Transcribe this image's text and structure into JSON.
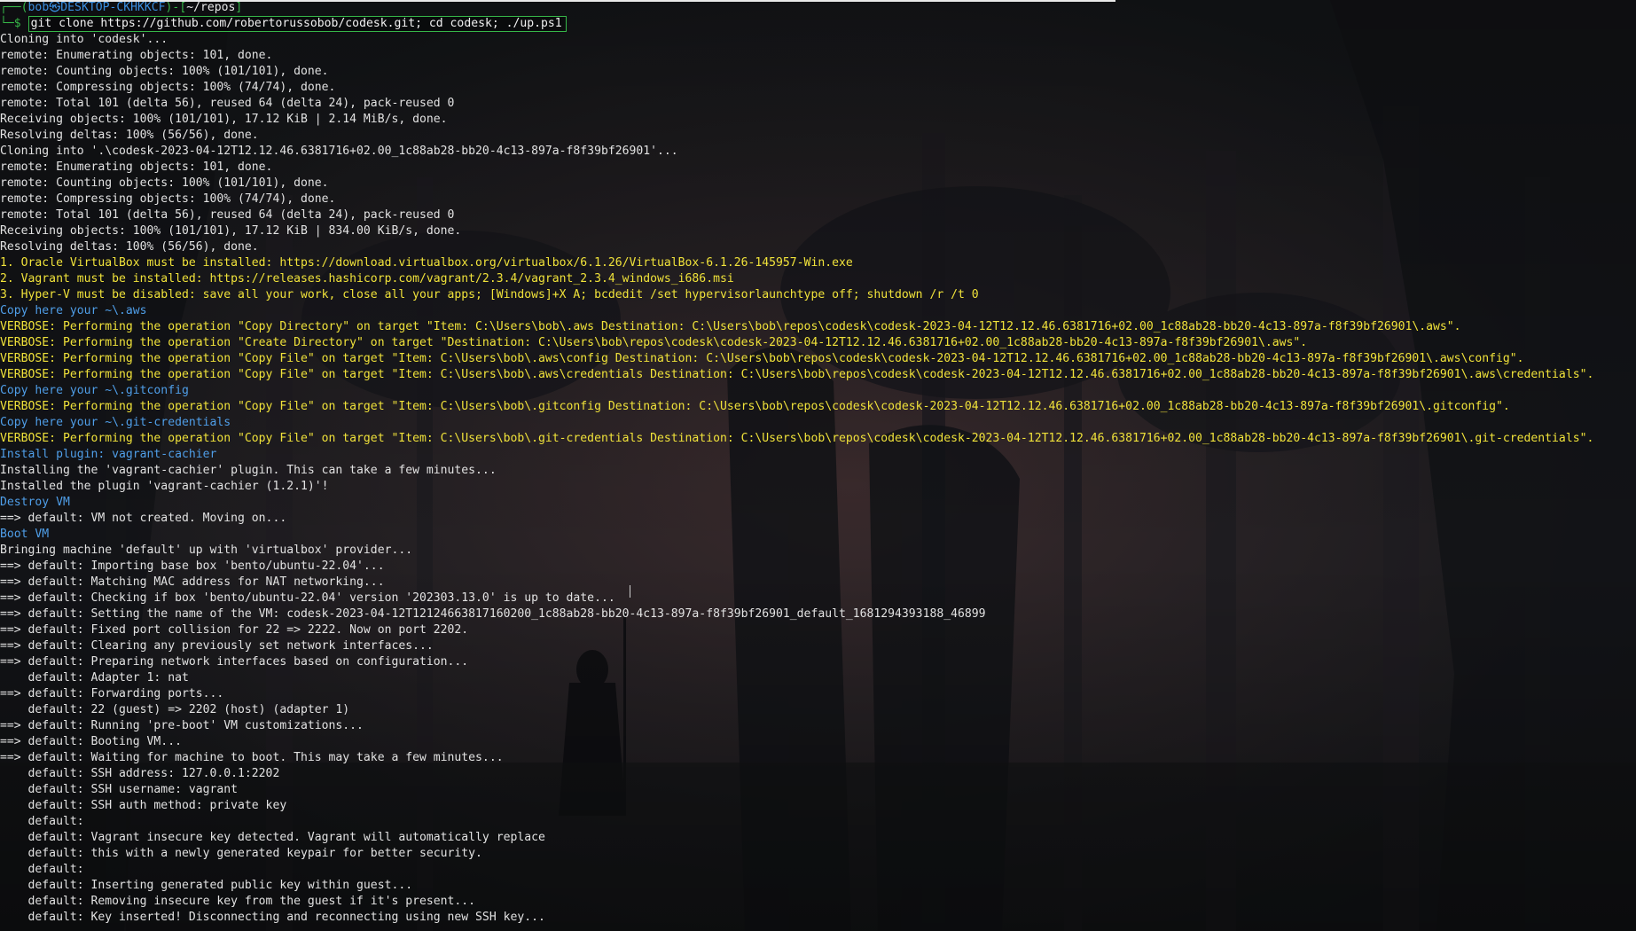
{
  "prompt": {
    "user_host": "bob㉿DESKTOP-CKHKKCF",
    "cwd": "~/repos",
    "symbol": "$",
    "command": "git clone https://github.com/robertorussobob/codesk.git; cd codesk; ./up.ps1"
  },
  "lines": [
    {
      "text": "Cloning into 'codesk'...",
      "c": "default"
    },
    {
      "text": "remote: Enumerating objects: 101, done.",
      "c": "default"
    },
    {
      "text": "remote: Counting objects: 100% (101/101), done.",
      "c": "default"
    },
    {
      "text": "remote: Compressing objects: 100% (74/74), done.",
      "c": "default"
    },
    {
      "text": "remote: Total 101 (delta 56), reused 64 (delta 24), pack-reused 0",
      "c": "default"
    },
    {
      "text": "Receiving objects: 100% (101/101), 17.12 KiB | 2.14 MiB/s, done.",
      "c": "default"
    },
    {
      "text": "Resolving deltas: 100% (56/56), done.",
      "c": "default"
    },
    {
      "text": "Cloning into '.\\codesk-2023-04-12T12.12.46.6381716+02.00_1c88ab28-bb20-4c13-897a-f8f39bf26901'...",
      "c": "default"
    },
    {
      "text": "remote: Enumerating objects: 101, done.",
      "c": "default"
    },
    {
      "text": "remote: Counting objects: 100% (101/101), done.",
      "c": "default"
    },
    {
      "text": "remote: Compressing objects: 100% (74/74), done.",
      "c": "default"
    },
    {
      "text": "remote: Total 101 (delta 56), reused 64 (delta 24), pack-reused 0",
      "c": "default"
    },
    {
      "text": "Receiving objects: 100% (101/101), 17.12 KiB | 834.00 KiB/s, done.",
      "c": "default"
    },
    {
      "text": "Resolving deltas: 100% (56/56), done.",
      "c": "default"
    },
    {
      "text": "1. Oracle VirtualBox must be installed: https://download.virtualbox.org/virtualbox/6.1.26/VirtualBox-6.1.26-145957-Win.exe",
      "c": "yellow"
    },
    {
      "text": "2. Vagrant must be installed: https://releases.hashicorp.com/vagrant/2.3.4/vagrant_2.3.4_windows_i686.msi",
      "c": "yellow"
    },
    {
      "text": "3. Hyper-V must be disabled: save all your work, close all your apps; [Windows]+X A; bcdedit /set hypervisorlaunchtype off; shutdown /r /t 0",
      "c": "yellow"
    },
    {
      "text": "Copy here your ~\\.aws",
      "c": "blue"
    },
    {
      "text": "VERBOSE: Performing the operation \"Copy Directory\" on target \"Item: C:\\Users\\bob\\.aws Destination: C:\\Users\\bob\\repos\\codesk\\codesk-2023-04-12T12.12.46.6381716+02.00_1c88ab28-bb20-4c13-897a-f8f39bf26901\\.aws\".",
      "c": "yellow"
    },
    {
      "text": "VERBOSE: Performing the operation \"Create Directory\" on target \"Destination: C:\\Users\\bob\\repos\\codesk\\codesk-2023-04-12T12.12.46.6381716+02.00_1c88ab28-bb20-4c13-897a-f8f39bf26901\\.aws\".",
      "c": "yellow"
    },
    {
      "text": "VERBOSE: Performing the operation \"Copy File\" on target \"Item: C:\\Users\\bob\\.aws\\config Destination: C:\\Users\\bob\\repos\\codesk\\codesk-2023-04-12T12.12.46.6381716+02.00_1c88ab28-bb20-4c13-897a-f8f39bf26901\\.aws\\config\".",
      "c": "yellow"
    },
    {
      "text": "VERBOSE: Performing the operation \"Copy File\" on target \"Item: C:\\Users\\bob\\.aws\\credentials Destination: C:\\Users\\bob\\repos\\codesk\\codesk-2023-04-12T12.12.46.6381716+02.00_1c88ab28-bb20-4c13-897a-f8f39bf26901\\.aws\\credentials\".",
      "c": "yellow"
    },
    {
      "text": "Copy here your ~\\.gitconfig",
      "c": "blue"
    },
    {
      "text": "VERBOSE: Performing the operation \"Copy File\" on target \"Item: C:\\Users\\bob\\.gitconfig Destination: C:\\Users\\bob\\repos\\codesk\\codesk-2023-04-12T12.12.46.6381716+02.00_1c88ab28-bb20-4c13-897a-f8f39bf26901\\.gitconfig\".",
      "c": "yellow"
    },
    {
      "text": "Copy here your ~\\.git-credentials",
      "c": "blue"
    },
    {
      "text": "VERBOSE: Performing the operation \"Copy File\" on target \"Item: C:\\Users\\bob\\.git-credentials Destination: C:\\Users\\bob\\repos\\codesk\\codesk-2023-04-12T12.12.46.6381716+02.00_1c88ab28-bb20-4c13-897a-f8f39bf26901\\.git-credentials\".",
      "c": "yellow"
    },
    {
      "text": "Install plugin: vagrant-cachier",
      "c": "blue"
    },
    {
      "text": "Installing the 'vagrant-cachier' plugin. This can take a few minutes...",
      "c": "default"
    },
    {
      "text": "Installed the plugin 'vagrant-cachier (1.2.1)'!",
      "c": "default"
    },
    {
      "text": "Destroy VM",
      "c": "blue"
    },
    {
      "text": "==> default: VM not created. Moving on...",
      "c": "default"
    },
    {
      "text": "Boot VM",
      "c": "blue"
    },
    {
      "text": "Bringing machine 'default' up with 'virtualbox' provider...",
      "c": "default"
    },
    {
      "text": "==> default: Importing base box 'bento/ubuntu-22.04'...",
      "c": "default"
    },
    {
      "text": "==> default: Matching MAC address for NAT networking...",
      "c": "default"
    },
    {
      "text": "==> default: Checking if box 'bento/ubuntu-22.04' version '202303.13.0' is up to date...",
      "c": "default"
    },
    {
      "text": "==> default: Setting the name of the VM: codesk-2023-04-12T12124663817160200_1c88ab28-bb20-4c13-897a-f8f39bf26901_default_1681294393188_46899",
      "c": "default"
    },
    {
      "text": "==> default: Fixed port collision for 22 => 2222. Now on port 2202.",
      "c": "default"
    },
    {
      "text": "==> default: Clearing any previously set network interfaces...",
      "c": "default"
    },
    {
      "text": "==> default: Preparing network interfaces based on configuration...",
      "c": "default"
    },
    {
      "text": "    default: Adapter 1: nat",
      "c": "default"
    },
    {
      "text": "==> default: Forwarding ports...",
      "c": "default"
    },
    {
      "text": "    default: 22 (guest) => 2202 (host) (adapter 1)",
      "c": "default"
    },
    {
      "text": "==> default: Running 'pre-boot' VM customizations...",
      "c": "default"
    },
    {
      "text": "==> default: Booting VM...",
      "c": "default"
    },
    {
      "text": "==> default: Waiting for machine to boot. This may take a few minutes...",
      "c": "default"
    },
    {
      "text": "    default: SSH address: 127.0.0.1:2202",
      "c": "default"
    },
    {
      "text": "    default: SSH username: vagrant",
      "c": "default"
    },
    {
      "text": "    default: SSH auth method: private key",
      "c": "default"
    },
    {
      "text": "    default:",
      "c": "default"
    },
    {
      "text": "    default: Vagrant insecure key detected. Vagrant will automatically replace",
      "c": "default"
    },
    {
      "text": "    default: this with a newly generated keypair for better security.",
      "c": "default"
    },
    {
      "text": "    default:",
      "c": "default"
    },
    {
      "text": "    default: Inserting generated public key within guest...",
      "c": "default"
    },
    {
      "text": "    default: Removing insecure key from the guest if it's present...",
      "c": "default"
    },
    {
      "text": "    default: Key inserted! Disconnecting and reconnecting using new SSH key...",
      "c": "default"
    }
  ]
}
